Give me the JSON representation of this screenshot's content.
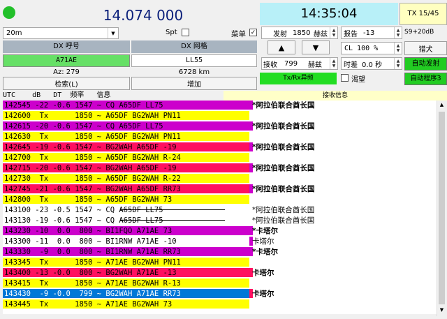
{
  "header": {
    "freq_display": "14.074 000",
    "time_display": "14:35:04",
    "tx_status": "TX 15/45",
    "led_color": "#22c02a"
  },
  "controls": {
    "band": "20m",
    "spt_label": "Spt",
    "menu_label": "菜单",
    "tx_label": "发射",
    "tx_freq": "1850",
    "hz_label": "赫兹",
    "report_label": "报告",
    "report_value": "-13",
    "s9_label": "S9+20dB",
    "up_arrow": "▲",
    "down_arrow": "▼",
    "cl_value": "CL  100 %",
    "hunt_label": "猎犬",
    "rx_label": "接收",
    "rx_freq": "799",
    "hz_label2": "赫兹",
    "time_offset_label": "时差",
    "time_offset_value": "0.0 秒",
    "auto_tx": "自动发射",
    "txrx_diff": "Tx/Rx异频",
    "watch_label": "渴望",
    "auto_prog": "自动程序3"
  },
  "dx": {
    "call_header": "DX 呼号",
    "grid_header": "DX 网格",
    "call_value": "A71AE",
    "grid_value": "LL55",
    "az": "Az: 279",
    "dist": "6728 km",
    "lookup": "检索(L)",
    "add": "增加"
  },
  "list_header": {
    "cols": "UTC    dB   DT  频率   信息",
    "rx_info": "接收信息"
  },
  "rows": [
    {
      "text": "142545 -22 -0.6 1547 ~ CQ A65DF LL75",
      "country": "*阿拉伯联合酋长国",
      "bg": "#cc00cc",
      "mark": "#cc00cc",
      "strike": false,
      "bold": true
    },
    {
      "text": "142600  Tx      1850 ~ A65DF BG2WAH PN11",
      "country": "",
      "bg": "#ffff00",
      "mark": "",
      "strike": false,
      "bold": false
    },
    {
      "text": "142615 -20 -0.6 1547 ~ CQ A65DF LL75",
      "country": "*阿拉伯联合酋长国",
      "bg": "#cc00cc",
      "mark": "#cc00cc",
      "strike": false,
      "bold": true
    },
    {
      "text": "142630  Tx      1850 ~ A65DF BG2WAH PN11",
      "country": "",
      "bg": "#ffff00",
      "mark": "",
      "strike": false,
      "bold": false
    },
    {
      "text": "142645 -19 -0.6 1547 ~ BG2WAH A65DF -19",
      "country": "*阿拉伯联合酋长国",
      "bg": "#ff1060",
      "mark": "#cc00cc",
      "strike": false,
      "bold": true
    },
    {
      "text": "142700  Tx      1850 ~ A65DF BG2WAH R-24",
      "country": "",
      "bg": "#ffff00",
      "mark": "",
      "strike": false,
      "bold": false
    },
    {
      "text": "142715 -20 -0.6 1547 ~ BG2WAH A65DF -19",
      "country": "*阿拉伯联合酋长国",
      "bg": "#ff1060",
      "mark": "#cc00cc",
      "strike": false,
      "bold": true
    },
    {
      "text": "142730  Tx      1850 ~ A65DF BG2WAH R-22",
      "country": "",
      "bg": "#ffff00",
      "mark": "",
      "strike": false,
      "bold": false
    },
    {
      "text": "142745 -21 -0.6 1547 ~ BG2WAH A65DF RR73",
      "country": "*阿拉伯联合酋长国",
      "bg": "#ff1060",
      "mark": "#cc00cc",
      "strike": false,
      "bold": true
    },
    {
      "text": "142800  Tx      1850 ~ A65DF BG2WAH 73",
      "country": "",
      "bg": "#ffff00",
      "mark": "",
      "strike": false,
      "bold": false
    },
    {
      "text": "143100 -23 -0.5 1547 ~ CQ A65DF LL75",
      "country": "*阿拉伯联合酋长国",
      "bg": "",
      "mark": "",
      "strike": true,
      "bold": false
    },
    {
      "text": "143130 -19 -0.6 1547 ~ CQ A65DF LL75",
      "country": "*阿拉伯联合酋长国",
      "bg": "",
      "mark": "",
      "strike": true,
      "bold": false
    },
    {
      "text": "143230 -10  0.0  800 ~ BI1FQO A71AE 73",
      "country": "*卡塔尔",
      "bg": "#cc00cc",
      "mark": "#cc00cc",
      "strike": false,
      "bold": true
    },
    {
      "text": "143300 -11  0.0  800 ~ BI1RNW A71AE -10",
      "country": "卡塔尔",
      "bg": "",
      "mark": "#cc00cc",
      "strike": false,
      "bold": false
    },
    {
      "text": "143330  -9  0.0  800 ~ BI1RNW A71AE RR73",
      "country": "*卡塔尔",
      "bg": "#cc00cc",
      "mark": "#cc00cc",
      "strike": false,
      "bold": true
    },
    {
      "text": "143345  Tx      1850 ~ A71AE BG2WAH PN11",
      "country": "",
      "bg": "#ffff00",
      "mark": "",
      "strike": false,
      "bold": false
    },
    {
      "text": "143400 -13 -0.0  800 ~ BG2WAH A71AE -13",
      "country": "卡塔尔",
      "bg": "#ff1060",
      "mark": "#ff1060",
      "strike": false,
      "bold": true
    },
    {
      "text": "143415  Tx      1850 ~ A71AE BG2WAH R-13",
      "country": "",
      "bg": "#ffff00",
      "mark": "",
      "strike": false,
      "bold": false
    },
    {
      "text": "143430  -9 -0.0  799 ~ BG2WAH A71AE RR73",
      "country": "卡塔尔",
      "bg": "#0078d7",
      "mark": "#ff1060",
      "strike": false,
      "bold": true
    },
    {
      "text": "143445  Tx      1850 ~ A71AE BG2WAH 73",
      "country": "",
      "bg": "#ffff00",
      "mark": "",
      "strike": false,
      "bold": false
    }
  ]
}
